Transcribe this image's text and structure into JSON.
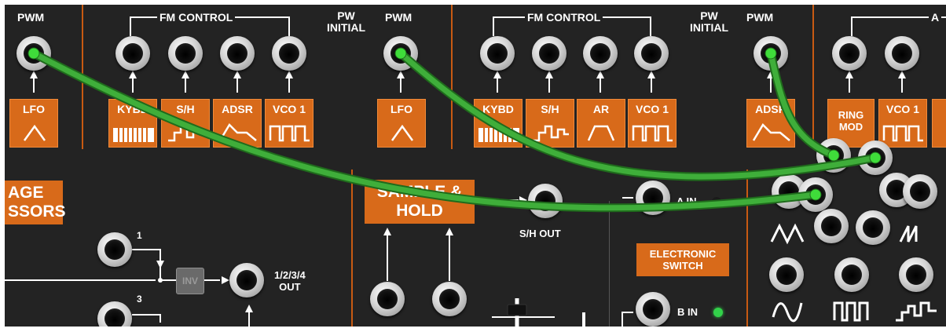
{
  "top_row": {
    "pwm_1": "PWM",
    "fm_control_1": "FM CONTROL",
    "pw_initial_1": "PW\nINITIAL",
    "pwm_2": "PWM",
    "fm_control_2": "FM CONTROL",
    "pw_initial_2": "PW\nINITIAL",
    "pwm_3": "PWM",
    "fm_control_3_partial": "A"
  },
  "source_boxes": [
    {
      "label": "LFO",
      "icon": "triangle-wave-icon"
    },
    {
      "label": "KYBD",
      "icon": "keyboard-icon"
    },
    {
      "label": "S/H",
      "icon": "sample-hold-wave-icon"
    },
    {
      "label": "ADSR",
      "icon": "adsr-envelope-icon"
    },
    {
      "label": "VCO 1",
      "icon": "square-wave-icon"
    },
    {
      "label": "LFO",
      "icon": "triangle-wave-icon"
    },
    {
      "label": "KYBD",
      "icon": "keyboard-icon"
    },
    {
      "label": "S/H",
      "icon": "sample-hold-wave-icon"
    },
    {
      "label": "AR",
      "icon": "ar-envelope-icon"
    },
    {
      "label": "VCO 1",
      "icon": "square-wave-icon"
    },
    {
      "label": "ADSR",
      "icon": "adsr-envelope-icon"
    },
    {
      "label": "RING\nMOD",
      "icon": ""
    },
    {
      "label": "VCO 1",
      "icon": "square-wave-icon"
    }
  ],
  "lower": {
    "voltage_processors_partial": "AGE\nSSORS",
    "input_1": "1",
    "input_3": "3",
    "inv_button": "INV",
    "mixer_out": "1/2/3/4\nOUT",
    "sample_hold": "SAMPLE &\nHOLD",
    "sh_out": "S/H OUT",
    "electronic_switch": "ELECTRONIC\nSWITCH",
    "a_in": "A IN",
    "b_in": "B IN"
  },
  "colors": {
    "panel": "#232323",
    "orange": "#d86a1a",
    "cable": "#3fae3a",
    "led": "#32d24a"
  }
}
